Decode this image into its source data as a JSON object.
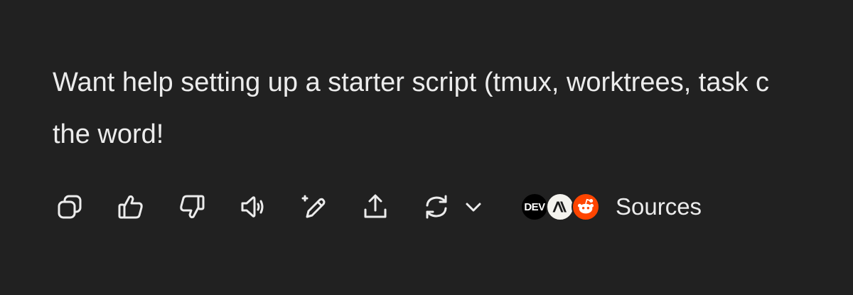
{
  "message": {
    "line1": "Want help setting up a starter script (tmux, worktrees, task c",
    "line2": "the word!"
  },
  "actions": {
    "copy_icon": "copy-icon",
    "thumbs_up_icon": "thumbs-up-icon",
    "thumbs_down_icon": "thumbs-down-icon",
    "read_aloud_icon": "speaker-icon",
    "edit_icon": "magic-pencil-icon",
    "share_icon": "share-icon",
    "regenerate_icon": "refresh-icon",
    "model_menu_icon": "chevron-down-icon"
  },
  "sources": {
    "label": "Sources",
    "favicons": [
      {
        "name": "dev-favicon",
        "text": "DEV",
        "color": "#000000"
      },
      {
        "name": "anthropic-favicon",
        "text": "A\\",
        "color": "#f4f3ee"
      },
      {
        "name": "reddit-favicon",
        "text": "",
        "color": "#ff4500"
      }
    ]
  },
  "colors": {
    "background": "#212121",
    "text": "#ececec",
    "reddit": "#ff4500"
  }
}
